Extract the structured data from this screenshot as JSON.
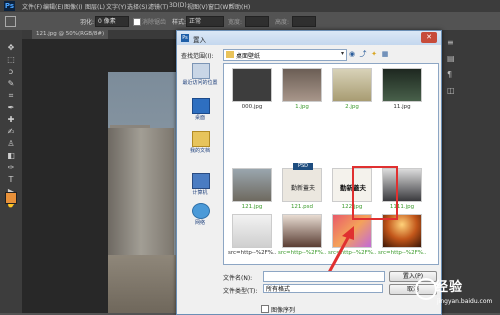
{
  "app": {
    "logo": "Ps",
    "menu": [
      "文件(F)",
      "编辑(E)",
      "图像(I)",
      "图层(L)",
      "文字(Y)",
      "选择(S)",
      "滤镜(T)",
      "3D(D)",
      "视图(V)",
      "窗口(W)",
      "帮助(H)"
    ],
    "options": {
      "feather_label": "羽化:",
      "feather_value": "0 像素",
      "antialias_label": "消除锯齿",
      "style_label": "样式:",
      "style_value": "正常",
      "width_label": "宽度:",
      "height_label": "高度:"
    },
    "doc_tab": "121.jpg @ 50%(RGB/8#)"
  },
  "dialog": {
    "title": "置入",
    "lookin_label": "查找范围(I):",
    "lookin_value": "桌面壁纸",
    "places": [
      {
        "label": "最近访问的位置",
        "icon": "recent-places-icon"
      },
      {
        "label": "桌面",
        "icon": "desktop-icon"
      },
      {
        "label": "我的文档",
        "icon": "documents-icon"
      },
      {
        "label": "计算机",
        "icon": "computer-icon"
      },
      {
        "label": "网络",
        "icon": "network-icon"
      }
    ],
    "files": [
      {
        "name": "000.jpg",
        "cap": "dark",
        "bg": "#3d3d3d"
      },
      {
        "name": "1.jpg",
        "cap": "green",
        "bg": "#8a7a6e"
      },
      {
        "name": "2.jpg",
        "cap": "green",
        "bg": "#c8c2a4"
      },
      {
        "name": "11.jpg",
        "cap": "dark",
        "bg": "#2e3a2f"
      },
      {
        "name": "121.jpg",
        "cap": "green",
        "bg": "#7a7468"
      },
      {
        "name": "121.psd",
        "cap": "green",
        "bg": "#e8e4dc"
      },
      {
        "name": "122.jpg",
        "cap": "green",
        "bg": "#f2f0ea"
      },
      {
        "name": "1111.jpg",
        "cap": "green",
        "bg": "#5a5a5e"
      },
      {
        "name": "src=http--%2F%...",
        "cap": "dark",
        "bg": "#e6e6e6"
      },
      {
        "name": "src=http--%2F%...",
        "cap": "green",
        "bg": "#d6c7bd"
      },
      {
        "name": "src=http--%2F%...",
        "cap": "green",
        "bg": "#d07aa8"
      },
      {
        "name": "src=http--%2F%...",
        "cap": "green",
        "bg": "#8a3a10"
      }
    ],
    "psd_badge": "PSD",
    "callig_text": "勤新蓋夫",
    "filename_label": "文件名(N):",
    "filename_value": "",
    "filetype_label": "文件类型(T):",
    "filetype_value": "所有格式",
    "place_button": "置入(P)",
    "cancel_button": "取消",
    "sequence_label": "图像序列"
  },
  "watermark": {
    "text": "Baidu 经验",
    "main": "经验",
    "sub": "jingyan.baidu.com"
  }
}
